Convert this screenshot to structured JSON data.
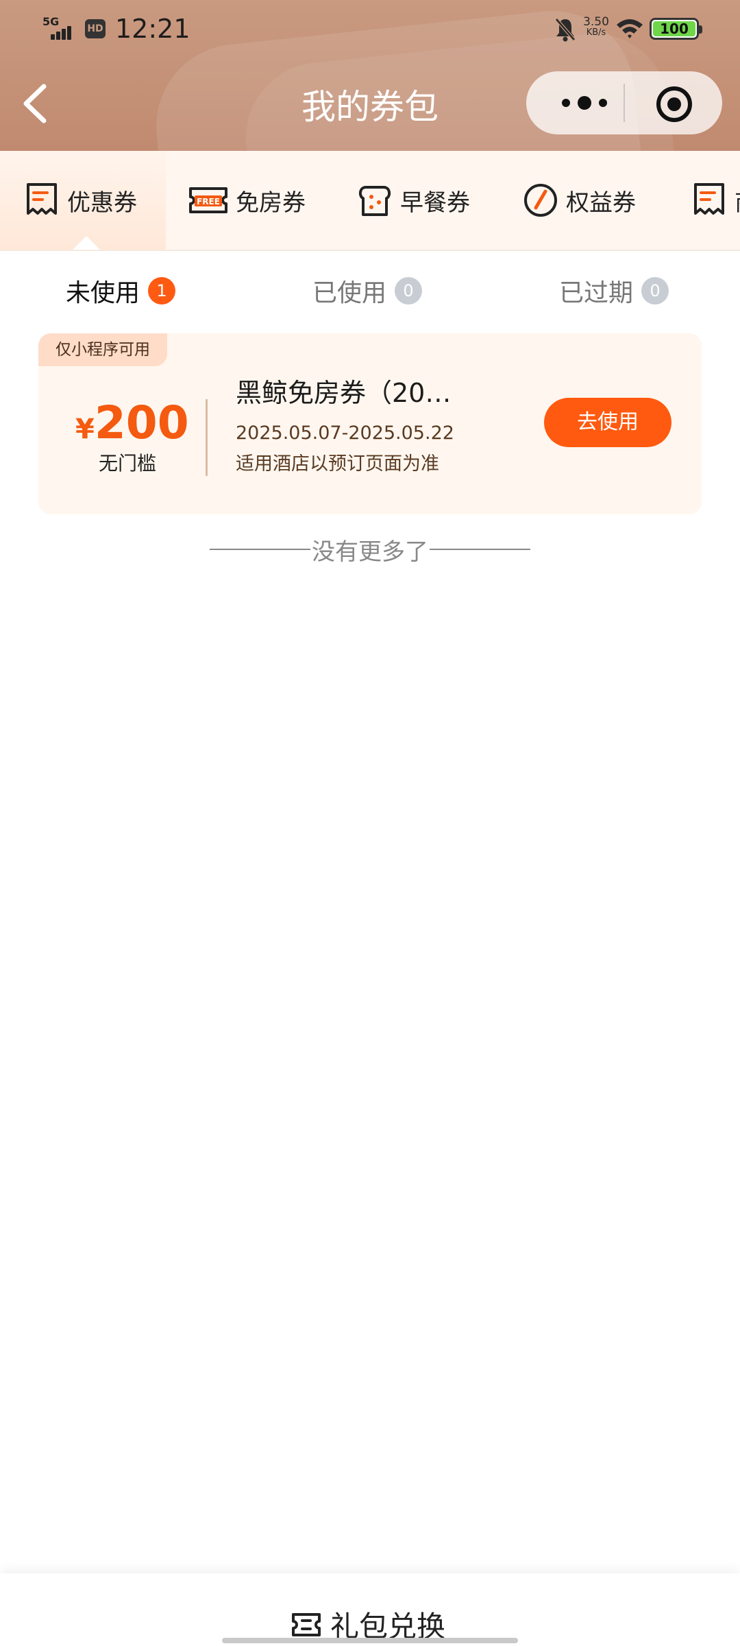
{
  "status_bar": {
    "network": "5G",
    "hd": "HD",
    "time": "12:21",
    "speed_value": "3.50",
    "speed_unit": "KB/s",
    "battery": "100"
  },
  "nav": {
    "title": "我的券包",
    "icons": [
      "back-icon",
      "more-icon",
      "target-icon"
    ]
  },
  "categories": [
    {
      "label": "优惠券",
      "icon": "coupon-receipt-icon",
      "active": true
    },
    {
      "label": "免房券",
      "icon": "free-ticket-icon",
      "active": false
    },
    {
      "label": "早餐券",
      "icon": "bread-icon",
      "active": false
    },
    {
      "label": "权益券",
      "icon": "gauge-icon",
      "active": false
    },
    {
      "label": "商",
      "icon": "coupon-receipt-icon",
      "active": false
    }
  ],
  "status_tabs": [
    {
      "label": "未使用",
      "count": "1",
      "active": true
    },
    {
      "label": "已使用",
      "count": "0",
      "active": false
    },
    {
      "label": "已过期",
      "count": "0",
      "active": false
    }
  ],
  "coupons": [
    {
      "tag": "仅小程序可用",
      "currency": "¥",
      "amount": "200",
      "threshold": "无门槛",
      "name": "黑鲸免房券（20…",
      "date_range": "2025.05.07-2025.05.22",
      "note": "适用酒店以预订页面为准",
      "action": "去使用"
    }
  ],
  "list_end": "没有更多了",
  "bottom": {
    "label": "礼包兑换",
    "icon": "ticket-icon"
  },
  "colors": {
    "header": "#c99a80",
    "accent": "#ff5a0f",
    "card_bg": "#fff7ef",
    "tag_bg": "#ffdcc8"
  }
}
